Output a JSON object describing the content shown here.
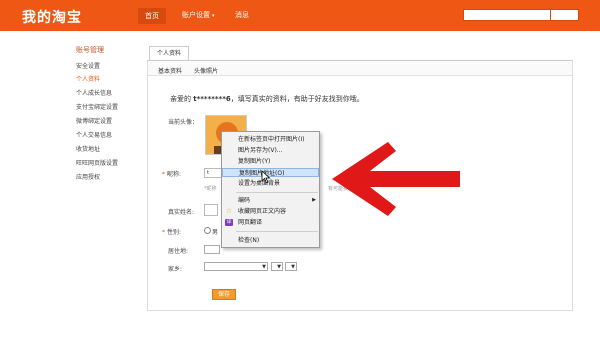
{
  "header": {
    "logo": "我的淘宝",
    "nav": {
      "home": "首页",
      "account": "账户设置",
      "account_caret": "▾",
      "messages": "消息"
    }
  },
  "sidebar": {
    "title": "账号管理",
    "items": [
      {
        "label": "安全设置",
        "active": false
      },
      {
        "label": "个人资料",
        "active": true
      },
      {
        "label": "个人成长信息",
        "active": false
      },
      {
        "label": "支付宝绑定设置",
        "active": false
      },
      {
        "label": "微博绑定设置",
        "active": false
      },
      {
        "label": "个人交易信息",
        "active": false
      },
      {
        "label": "收货地址",
        "active": false
      },
      {
        "label": "旺旺网页版设置",
        "active": false
      },
      {
        "label": "应用授权",
        "active": false
      }
    ]
  },
  "main": {
    "tab": "个人资料",
    "subtabs": [
      "基本资料",
      "头像照片"
    ],
    "greeting_prefix": "亲爱的",
    "username": "t********6",
    "greeting_suffix": "，填写真实的资料，有助于好友找到你哦。",
    "labels": {
      "avatar": "当前头像：",
      "nickname": "昵称:",
      "realname": "真实姓名:",
      "gender": "性别:",
      "residence": "居住地:",
      "hometown": "家乡:"
    },
    "avatar_tag": "淘",
    "nickname_value": "t",
    "nickname_hint": "*昵称",
    "nickname_hint_right": "有可能被",
    "gender_option": "男",
    "save_label": "保存"
  },
  "context_menu": {
    "items": [
      {
        "label": "在新标签页中打开图片(I)"
      },
      {
        "label": "图片另存为(V)..."
      },
      {
        "label": "复制图片(Y)"
      },
      {
        "label": "复制图片地址(O)",
        "highlighted": true
      },
      {
        "label": "设置为桌面背景"
      },
      {
        "label": "编码",
        "submenu_arrow": "▶"
      },
      {
        "label": "收藏网页正文内容",
        "icon": "star-icon",
        "icon_glyph": "☆"
      },
      {
        "label": "网页翻译",
        "icon": "translate-icon",
        "icon_glyph": "译"
      },
      {
        "label": "检查(N)"
      }
    ]
  },
  "colors": {
    "brand": "#ee5714",
    "arrow": "#e01818",
    "menu_highlight": "#cfe3fa",
    "save_button": "#f39a2d"
  }
}
